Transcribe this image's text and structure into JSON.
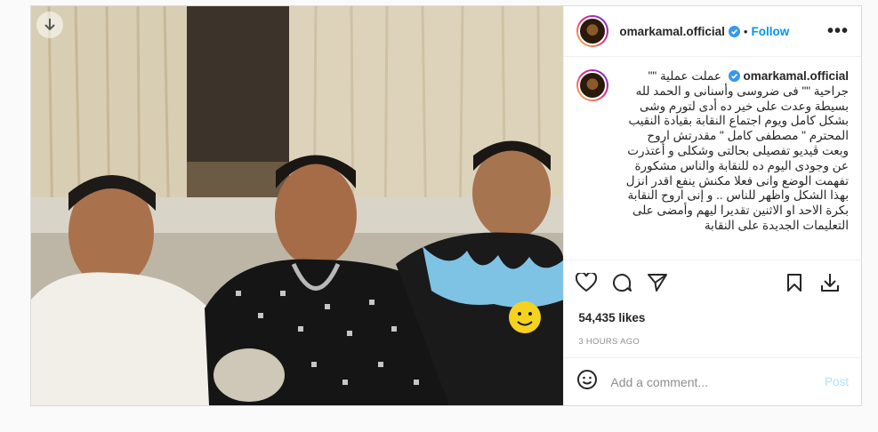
{
  "post": {
    "author": "omarkamal.official",
    "verified": true,
    "follow_label": "Follow",
    "more_label": "•••",
    "caption": "عملت عملية \"\" جراحية \"\" فى ضروسى وأسنانى و الحمد لله بسيطة وعدت على خير ده أدى لتورم وشى بشكل كامل ويوم اجتماع النقابة بقيادة النقيب المحترم \" مصطفى كامل \" مقدرتش اروح وبعت ڤيديو تفصيلى بحالتى وشكلى و أعتذرت عن وجودى اليوم ده للنقابة والناس مشكورة تفهمت الوضع وانى فعلا مكنش ينفع اقدر انزل بهذا الشكل واظهر للناس .. و إنى اروح النقابة بكرة الاحد او الاثنين تقديرا ليهم وأمضى على التعليمات الجديدة على النقابة",
    "likes": "54,435 likes",
    "time": "3 HOURS AGO",
    "comment_placeholder": "Add a comment...",
    "post_button": "Post"
  },
  "icons": {
    "download": "download-arrow-icon",
    "verified": "verified-badge-icon",
    "like": "heart-icon",
    "comment": "comment-bubble-icon",
    "share": "paper-plane-icon",
    "save": "bookmark-icon",
    "download_post": "download-tray-icon",
    "emoji": "smiley-icon"
  },
  "colors": {
    "accent": "#0095f6",
    "post_disabled": "#b2dffc",
    "muted": "#8e8e8e",
    "border": "#dbdbdb"
  }
}
